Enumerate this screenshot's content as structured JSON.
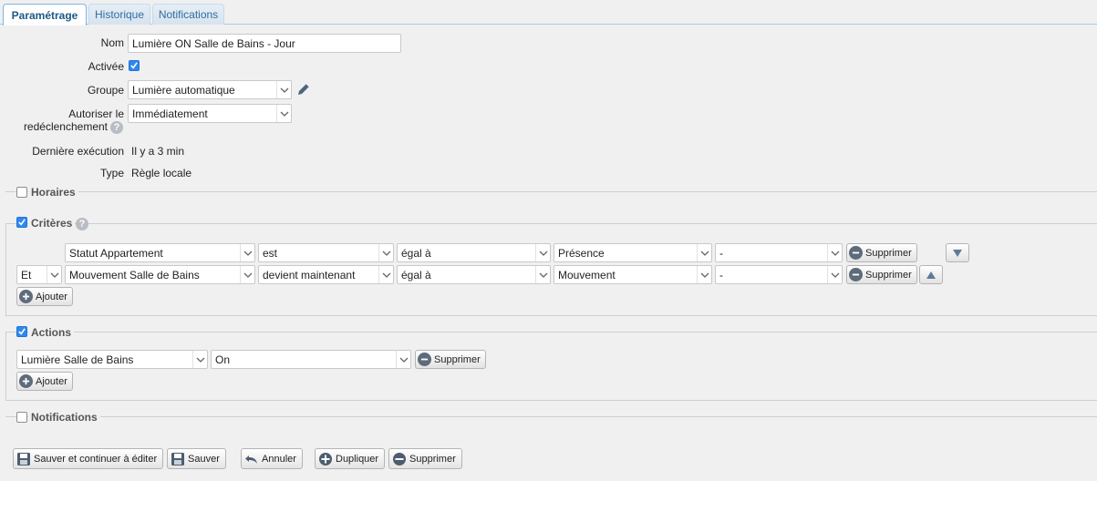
{
  "tabs": [
    {
      "label": "Paramétrage",
      "active": true
    },
    {
      "label": "Historique",
      "active": false
    },
    {
      "label": "Notifications",
      "active": false
    }
  ],
  "form": {
    "name_label": "Nom",
    "name_value": "Lumière ON Salle de Bains - Jour",
    "enabled_label": "Activée",
    "enabled": true,
    "group_label": "Groupe",
    "group_value": "Lumière automatique",
    "retrigger_label_1": "Autoriser le",
    "retrigger_label_2": "redéclenchement",
    "retrigger_value": "Immédiatement",
    "last_run_label": "Dernière exécution",
    "last_run_value": "Il y a 3 min",
    "type_label": "Type",
    "type_value": "Règle locale"
  },
  "sections": {
    "schedules": {
      "label": "Horaires",
      "checked": false
    },
    "criteria": {
      "label": "Critères",
      "checked": true
    },
    "actions": {
      "label": "Actions",
      "checked": true
    },
    "notifications": {
      "label": "Notifications",
      "checked": false
    }
  },
  "criteria_rows": [
    {
      "connector": "",
      "subject": "Statut Appartement",
      "verb": "est",
      "operator": "égal à",
      "value": "Présence",
      "extra": "-",
      "delete_label": "Supprimer"
    },
    {
      "connector": "Et",
      "subject": "Mouvement Salle de Bains",
      "verb": "devient maintenant",
      "operator": "égal à",
      "value": "Mouvement",
      "extra": "-",
      "delete_label": "Supprimer"
    }
  ],
  "criteria_add_label": "Ajouter",
  "action_rows": [
    {
      "device": "Lumière Salle de Bains",
      "command": "On",
      "delete_label": "Supprimer"
    }
  ],
  "actions_add_label": "Ajouter",
  "footer": {
    "save_continue": "Sauver et continuer à éditer",
    "save": "Sauver",
    "cancel": "Annuler",
    "duplicate": "Dupliquer",
    "delete": "Supprimer"
  },
  "colors": {
    "accent": "#2f88f0",
    "tab_text": "#2e6e9e",
    "background": "#f0f0f0"
  }
}
